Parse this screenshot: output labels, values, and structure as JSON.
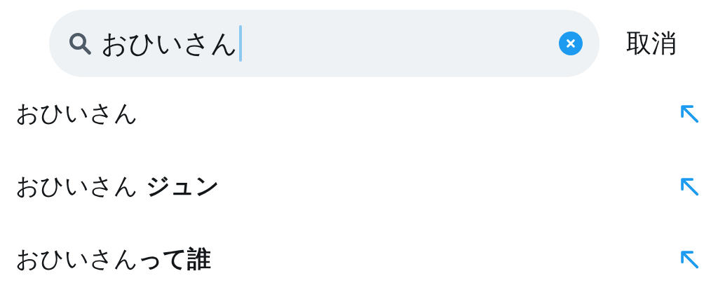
{
  "search": {
    "value": "おひいさん",
    "cancel": "取消"
  },
  "suggestions": [
    {
      "text": "おひいさん"
    },
    {
      "text": "おひいさん **ジュン**"
    },
    {
      "text": "おひいさん**って誰**"
    }
  ]
}
